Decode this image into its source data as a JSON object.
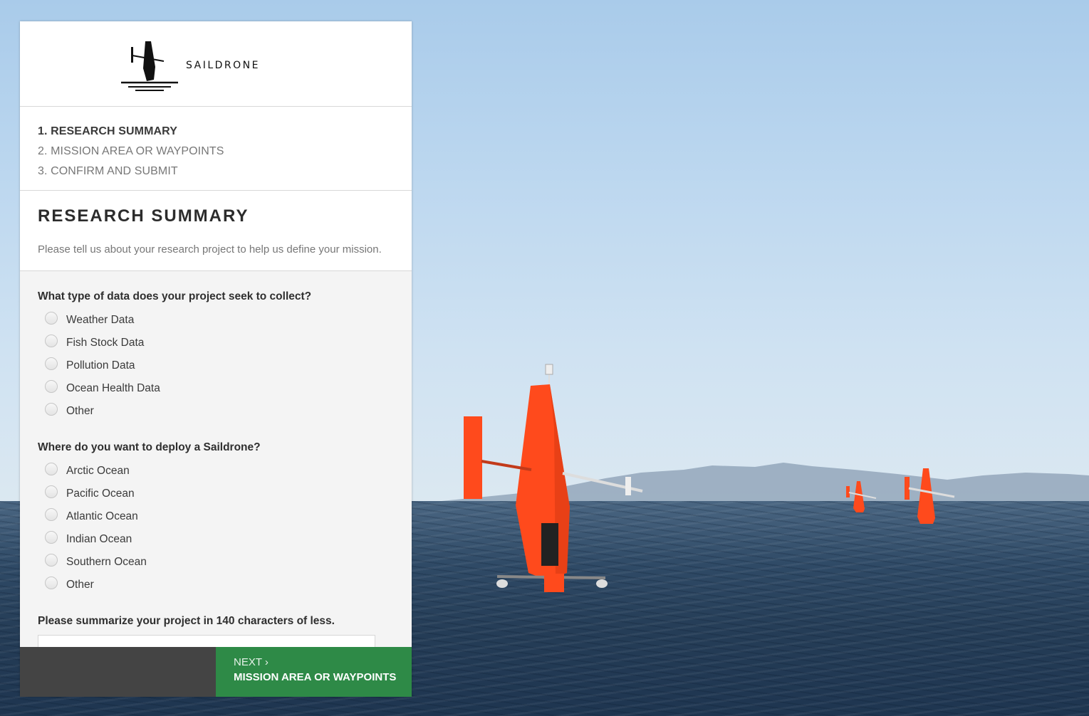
{
  "brand": {
    "name": "SAILDRONE"
  },
  "steps": [
    {
      "number": "1.",
      "label": "RESEARCH SUMMARY"
    },
    {
      "number": "2.",
      "label": "MISSION AREA OR WAYPOINTS"
    },
    {
      "number": "3.",
      "label": "CONFIRM AND SUBMIT"
    }
  ],
  "section": {
    "title": "RESEARCH SUMMARY",
    "description": "Please tell us about your research project to help us define your mission."
  },
  "questions": {
    "data_type": {
      "label": "What type of data does your project seek to collect?",
      "options": [
        "Weather Data",
        "Fish Stock Data",
        "Pollution Data",
        "Ocean Health Data",
        "Other"
      ]
    },
    "deploy": {
      "label": "Where do you want to deploy a Saildrone?",
      "options": [
        "Arctic Ocean",
        "Pacific Ocean",
        "Atlantic Ocean",
        "Indian Ocean",
        "Southern Ocean",
        "Other"
      ]
    },
    "summary": {
      "label": "Please summarize your project in 140 characters of less.",
      "value": ""
    }
  },
  "footer": {
    "next_prefix": "NEXT ›",
    "next_label": "MISSION AREA OR WAYPOINTS"
  },
  "colors": {
    "accent": "#2e8a47",
    "footer_back": "#444444",
    "drone": "#ff4a1c"
  }
}
